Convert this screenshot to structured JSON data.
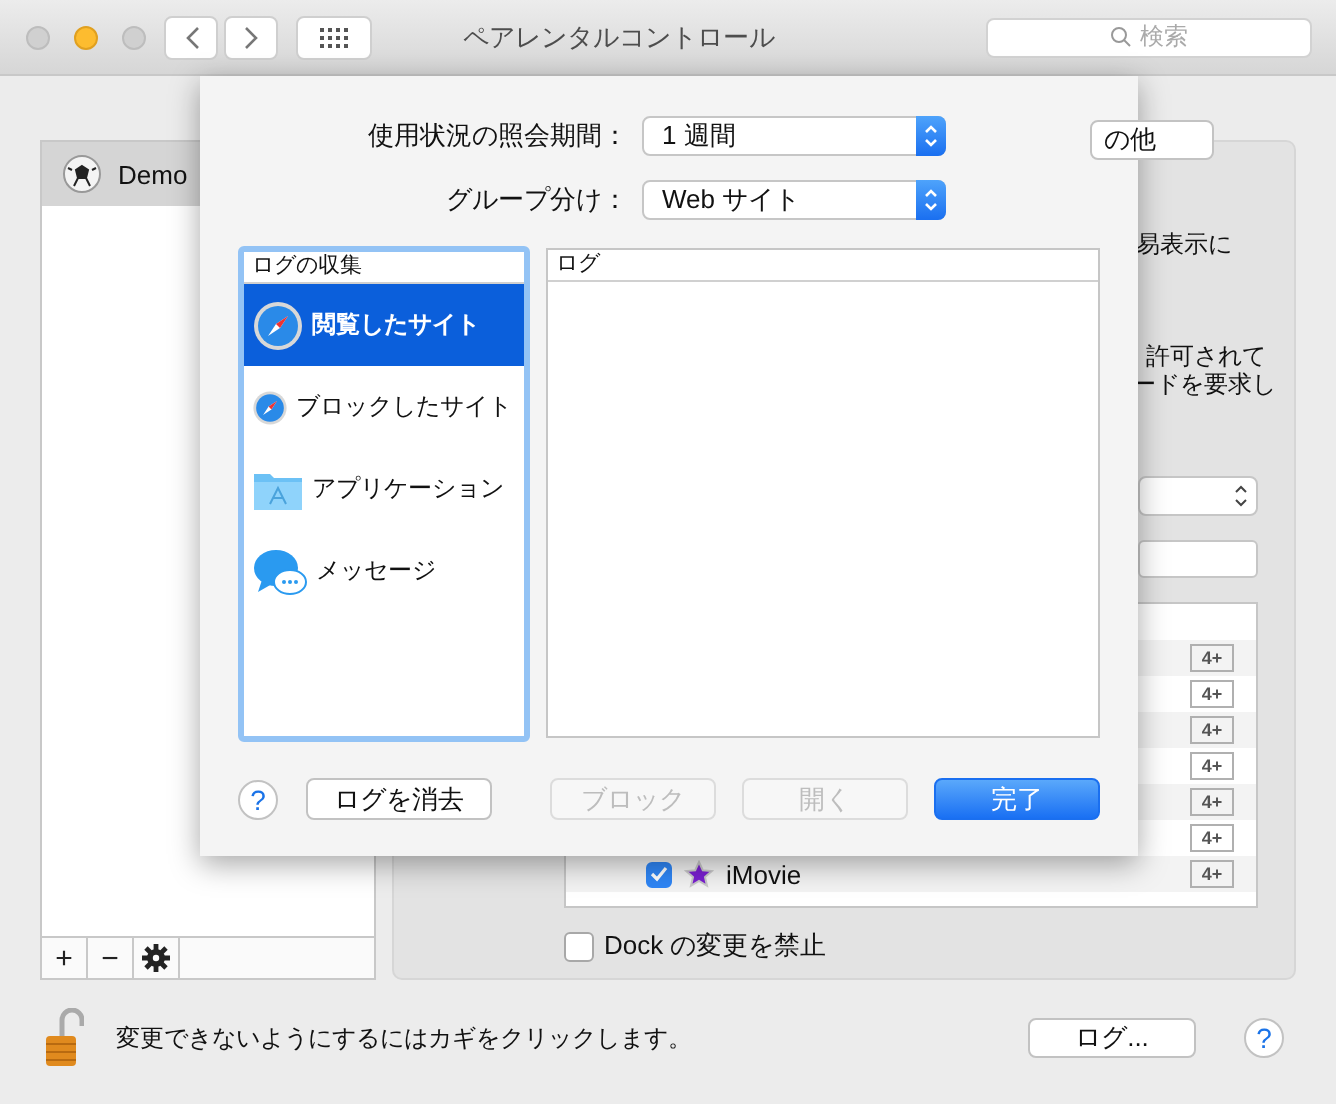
{
  "window": {
    "title": "ペアレンタルコントロール",
    "search_placeholder": "検索"
  },
  "users": [
    {
      "name": "Demo",
      "selected": true
    }
  ],
  "user_list_buttons": [
    "+",
    "−"
  ],
  "tab": {
    "label": "の他"
  },
  "panel_texts": [
    "易表示に",
    "許可されて",
    "ードを要求し"
  ],
  "apps": [
    {
      "rating": "4+"
    },
    {
      "rating": "4+"
    },
    {
      "rating": "4+"
    },
    {
      "rating": "4+"
    },
    {
      "rating": "4+"
    },
    {
      "rating": "4+"
    },
    {
      "name": "iMovie",
      "checked": true,
      "rating": "4+"
    }
  ],
  "dock_option": {
    "label": "Dock の変更を禁止",
    "checked": false
  },
  "lock_text": "変更できないようにするにはカギをクリックします。",
  "log_button": "ログ...",
  "help": "?",
  "sheet": {
    "fields": [
      {
        "label": "使用状況の照会期間：",
        "value": "1 週間"
      },
      {
        "label": "グループ分け：",
        "value": "Web サイト"
      }
    ],
    "collect_list": {
      "header": "ログの収集",
      "items": [
        {
          "label": "閲覧したサイト",
          "kind": "safari",
          "selected": true
        },
        {
          "label": "ブロックしたサイト",
          "kind": "safari",
          "selected": false
        },
        {
          "label": "アプリケーション",
          "kind": "folder",
          "selected": false
        },
        {
          "label": "メッセージ",
          "kind": "messages",
          "selected": false
        }
      ]
    },
    "log_list": {
      "header": "ログ"
    },
    "help": "?",
    "buttons": [
      {
        "label": "ログを消去",
        "kind": "normal",
        "disabled": false
      },
      {
        "label": "ブロック",
        "kind": "normal",
        "disabled": true
      },
      {
        "label": "開く",
        "kind": "normal",
        "disabled": true
      },
      {
        "label": "完了",
        "kind": "default",
        "disabled": false
      }
    ]
  }
}
